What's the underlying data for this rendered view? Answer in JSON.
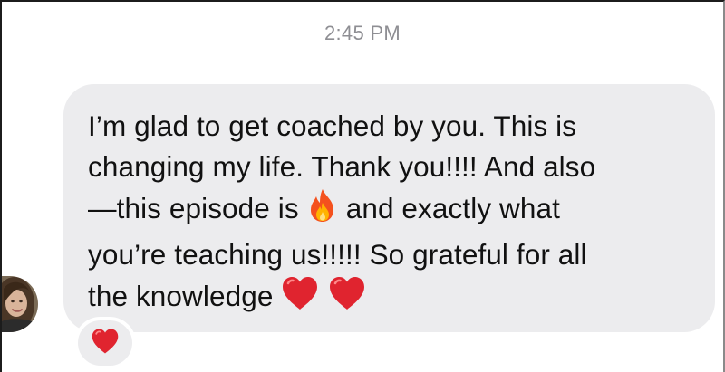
{
  "thread": {
    "timestamp": "2:45 PM"
  },
  "message": {
    "line1": "I’m glad to get coached by you. This is",
    "line2": "changing my life. Thank you!!!! And also",
    "line3_before_emoji": "—this episode is",
    "line3_emoji": "fire-emoji",
    "line3_after_emoji": "and exactly what",
    "line4": "you’re teaching us!!!!! So grateful for all",
    "line5": "the knowledge",
    "line5_emojis": [
      "red-heart-emoji",
      "red-heart-emoji"
    ]
  },
  "sender": {
    "avatar": "profile-photo"
  },
  "reaction": {
    "emoji": "red-heart-emoji"
  },
  "colors": {
    "bubble": "#ececee",
    "timestamp": "#8e8e93",
    "text": "#111111",
    "heart": "#e0242f",
    "flame_outer": "#f4511e",
    "flame_inner": "#ffb300"
  }
}
